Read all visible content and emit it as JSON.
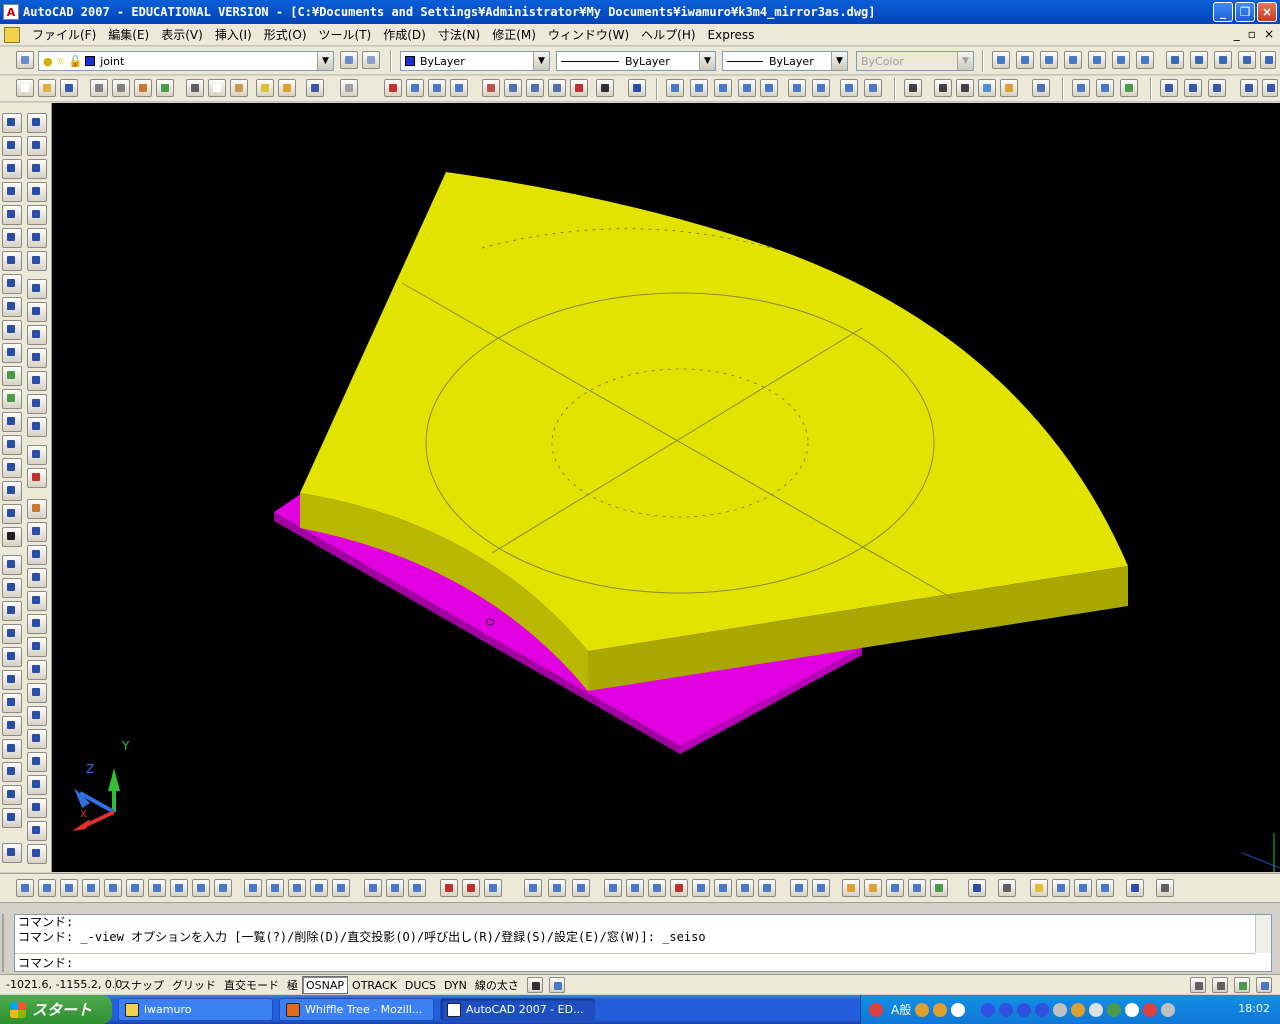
{
  "window": {
    "title": "AutoCAD 2007 - EDUCATIONAL VERSION - [C:¥Documents and Settings¥Administrator¥My Documents¥iwamuro¥k3m4_mirror3as.dwg]",
    "minimize": "_",
    "restore": "❐",
    "close": "×"
  },
  "menu": {
    "items": [
      "ファイル(F)",
      "編集(E)",
      "表示(V)",
      "挿入(I)",
      "形式(O)",
      "ツール(T)",
      "作成(D)",
      "寸法(N)",
      "修正(M)",
      "ウィンドウ(W)",
      "ヘルプ(H)",
      "Express"
    ],
    "mdi_min": "_",
    "mdi_restore": "▫",
    "mdi_close": "×"
  },
  "layer": {
    "current": "joint"
  },
  "properties": {
    "color": "ByLayer",
    "linetype": "ByLayer",
    "lineweight": "ByLayer",
    "plotstyle": "ByColor"
  },
  "ucs": {
    "x": "X",
    "y": "Y",
    "z": "Z"
  },
  "command": {
    "history": [
      "コマンド:",
      "コマンド: _-view オプションを入力 [一覧(?)/削除(D)/直交投影(O)/呼び出し(R)/登録(S)/設定(E)/窓(W)]: _seiso"
    ],
    "prompt": "コマンド:"
  },
  "status": {
    "coords": "-1021.6, -1155.2, 0.0",
    "buttons": [
      {
        "label": "スナップ",
        "on": false
      },
      {
        "label": "グリッド",
        "on": false
      },
      {
        "label": "直交モード",
        "on": false
      },
      {
        "label": "極",
        "on": false
      },
      {
        "label": "OSNAP",
        "on": true
      },
      {
        "label": "OTRACK",
        "on": false
      },
      {
        "label": "DUCS",
        "on": false
      },
      {
        "label": "DYN",
        "on": false
      },
      {
        "label": "線の太さ",
        "on": false
      }
    ]
  },
  "taskbar": {
    "start": "スタート",
    "tasks": [
      {
        "label": "iwamuro",
        "active": false
      },
      {
        "label": "Whiffle Tree - Mozill...",
        "active": false
      },
      {
        "label": "AutoCAD 2007 - ED...",
        "active": true
      }
    ],
    "ime": "A般",
    "clock": "18:02"
  },
  "colors": {
    "model_top": "#e3e300",
    "model_side": "#b8b800",
    "plate": "#e000e0",
    "viewport": "#000000"
  }
}
